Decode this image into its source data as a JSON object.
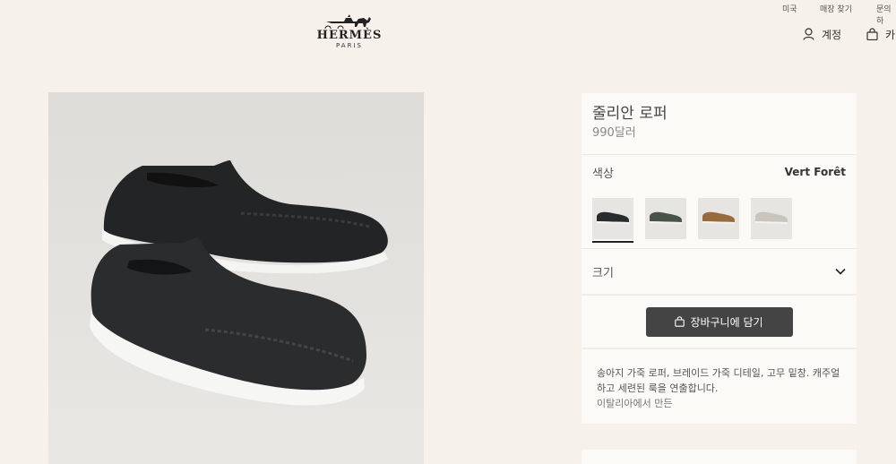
{
  "utility_nav": {
    "country": "미국",
    "store_finder": "매장 찾기",
    "contact": "문의하"
  },
  "brand": {
    "name": "HERMÈS",
    "city": "PARIS"
  },
  "header": {
    "account_label": "계정",
    "cart_label": "카"
  },
  "product": {
    "name": "줄리안 로퍼",
    "price": "990달러",
    "color_label": "색상",
    "color_value": "Vert Forêt",
    "swatches": [
      {
        "icon": "loafer-black-thumbnail",
        "color": "#2a2b2d",
        "selected": true
      },
      {
        "icon": "loafer-green-thumbnail",
        "color": "#4a5347",
        "selected": false
      },
      {
        "icon": "loafer-brown-thumbnail",
        "color": "#9a6a3f",
        "selected": false
      },
      {
        "icon": "loafer-beige-thumbnail",
        "color": "#c9c5bc",
        "selected": false
      }
    ],
    "size_label": "크기",
    "add_to_cart": "장바구니에 담기",
    "description": "송아지 가죽 로퍼, 브레이드 가죽 디테일, 고무 밑창. 캐주얼하고 세련된 룩을 연출합니다.",
    "made_in": "이탈리아에서 만든"
  },
  "colors": {
    "background": "#f6f1eb",
    "panel": "#fcfaf7",
    "button": "#444444",
    "photo_bg": "#e3e1dd"
  }
}
